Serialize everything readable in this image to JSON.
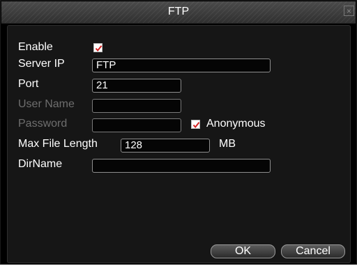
{
  "dialog": {
    "title": "FTP",
    "close_glyph": "×"
  },
  "form": {
    "enable": {
      "label": "Enable",
      "checked": true
    },
    "server_ip": {
      "label": "Server IP",
      "value": "FTP"
    },
    "port": {
      "label": "Port",
      "value": "21"
    },
    "user_name": {
      "label": "User Name",
      "value": ""
    },
    "password": {
      "label": "Password",
      "value": ""
    },
    "anonymous": {
      "label": "Anonymous",
      "checked": true
    },
    "max_file_length": {
      "label": "Max File Length",
      "value": "128",
      "unit": "MB"
    },
    "dir_name": {
      "label": "DirName",
      "value": ""
    }
  },
  "buttons": {
    "ok": "OK",
    "cancel": "Cancel"
  },
  "colors": {
    "checkmark": "#d42020",
    "disabled_text": "#6e6e6e"
  }
}
